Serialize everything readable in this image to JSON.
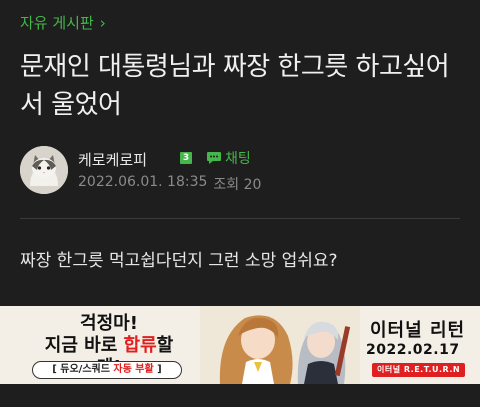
{
  "board": {
    "label": "자유 게시판",
    "chevron": "›"
  },
  "post": {
    "title": "문재인 대통령님과 짜장 한그릇 하고싶어서 울었어",
    "body": "짜장 한그릇 먹고쉽다던지 그런 소망 업쉬요?"
  },
  "author": {
    "name": "케로케로피",
    "level": "3",
    "chat_label": "채팅",
    "date": "2022.06.01. 18:35",
    "views": "조회 20",
    "avatar_icon": "cat-avatar"
  },
  "ad": {
    "headline1": "걱정마!",
    "headline2_pre": "지금 바로 ",
    "headline2_hl": "합류",
    "headline2_post": "할게!",
    "pill_pre": "[ 듀오/스쿼드 ",
    "pill_hl": "자동 부활",
    "pill_post": " ]",
    "game_title": "이터널 리턴",
    "date": "2022.02.17",
    "tag": "이터널 R.E.T.U.R.N"
  },
  "colors": {
    "accent": "#45b649",
    "background": "#1e1e1e",
    "ad_red": "#e02020"
  }
}
